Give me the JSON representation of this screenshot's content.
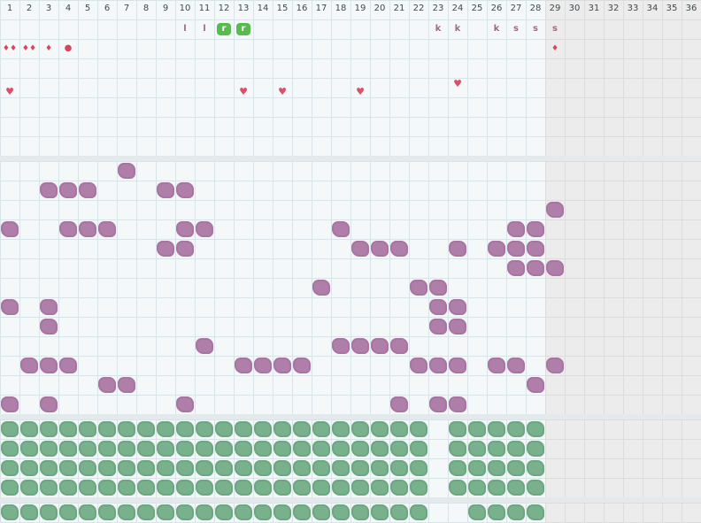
{
  "app": {
    "label": "cycle tracker calendar grid"
  },
  "days": [
    "1",
    "2",
    "3",
    "4",
    "5",
    "6",
    "7",
    "8",
    "9",
    "10",
    "11",
    "12",
    "13",
    "14",
    "15",
    "16",
    "17",
    "18",
    "19",
    "20",
    "21",
    "22",
    "23",
    "24",
    "25",
    "26",
    "27",
    "28",
    "29",
    "30",
    "31",
    "32",
    "33",
    "34",
    "35",
    "36"
  ],
  "colors": {
    "mauve": "#b07fa9",
    "green": "#79b18d",
    "drop": "#d9455f",
    "heart": "#d9506b",
    "badge_green": "#58bb4d"
  },
  "letters": [
    {
      "day": 10,
      "text": "l",
      "style": "plain"
    },
    {
      "day": 11,
      "text": "l",
      "style": "plain"
    },
    {
      "day": 12,
      "text": "r",
      "style": "green"
    },
    {
      "day": 13,
      "text": "r",
      "style": "green"
    },
    {
      "day": 23,
      "text": "k",
      "style": "plain"
    },
    {
      "day": 24,
      "text": "k",
      "style": "plain"
    },
    {
      "day": 26,
      "text": "k",
      "style": "plain"
    },
    {
      "day": 27,
      "text": "s",
      "style": "plain"
    },
    {
      "day": 28,
      "text": "s",
      "style": "plain"
    },
    {
      "day": 29,
      "text": "s",
      "style": "plain"
    }
  ],
  "flow_markers": [
    {
      "day": 1,
      "glyph": "♦♦",
      "icon": "double-drop-icon"
    },
    {
      "day": 2,
      "glyph": "♦♦",
      "icon": "double-drop-icon"
    },
    {
      "day": 3,
      "glyph": "♦",
      "icon": "drop-icon"
    },
    {
      "day": 4,
      "glyph": "●",
      "icon": "spot-icon"
    },
    {
      "day": 29,
      "glyph": "♦",
      "icon": "drop-icon"
    }
  ],
  "heart_markers": [
    {
      "day": 1,
      "glyph": "♥",
      "raised": false
    },
    {
      "day": 13,
      "glyph": "♥",
      "raised": false
    },
    {
      "day": 15,
      "glyph": "♥",
      "raised": false
    },
    {
      "day": 19,
      "glyph": "♥",
      "raised": false
    },
    {
      "day": 24,
      "glyph": "♥",
      "raised": true
    }
  ],
  "symptom_rows": [
    [
      7
    ],
    [
      3,
      4,
      5,
      9,
      10
    ],
    [
      29
    ],
    [
      1,
      4,
      5,
      6,
      10,
      11,
      18,
      27,
      28
    ],
    [
      9,
      10,
      19,
      20,
      21,
      24,
      26,
      27,
      28
    ],
    [
      27,
      28,
      29
    ],
    [
      17,
      22,
      23
    ],
    [
      1,
      3,
      23,
      24
    ],
    [
      3,
      23,
      24
    ],
    [
      11,
      18,
      19,
      20,
      21
    ],
    [
      2,
      3,
      4,
      13,
      14,
      15,
      16,
      22,
      23,
      24,
      26,
      27,
      29
    ],
    [
      6,
      7,
      28
    ],
    [
      1,
      3,
      10,
      21,
      23,
      24
    ]
  ],
  "green_rows": [
    [
      1,
      2,
      3,
      4,
      5,
      6,
      7,
      8,
      9,
      10,
      11,
      12,
      13,
      14,
      15,
      16,
      17,
      18,
      19,
      20,
      21,
      22,
      24,
      25,
      26,
      27,
      28
    ],
    [
      1,
      2,
      3,
      4,
      5,
      6,
      7,
      8,
      9,
      10,
      11,
      12,
      13,
      14,
      15,
      16,
      17,
      18,
      19,
      20,
      21,
      22,
      24,
      25,
      26,
      27,
      28
    ],
    [
      1,
      2,
      3,
      4,
      5,
      6,
      7,
      8,
      9,
      10,
      11,
      12,
      13,
      14,
      15,
      16,
      17,
      18,
      19,
      20,
      21,
      22,
      24,
      25,
      26,
      27,
      28
    ],
    [
      1,
      2,
      3,
      4,
      5,
      6,
      7,
      8,
      9,
      10,
      11,
      12,
      13,
      14,
      15,
      16,
      17,
      18,
      19,
      20,
      21,
      22,
      24,
      25,
      26,
      27,
      28
    ]
  ],
  "bottom_row": [
    1,
    2,
    3,
    4,
    5,
    6,
    7,
    8,
    9,
    10,
    11,
    12,
    13,
    14,
    15,
    16,
    17,
    18,
    19,
    20,
    21,
    22,
    25,
    26,
    27,
    28
  ]
}
